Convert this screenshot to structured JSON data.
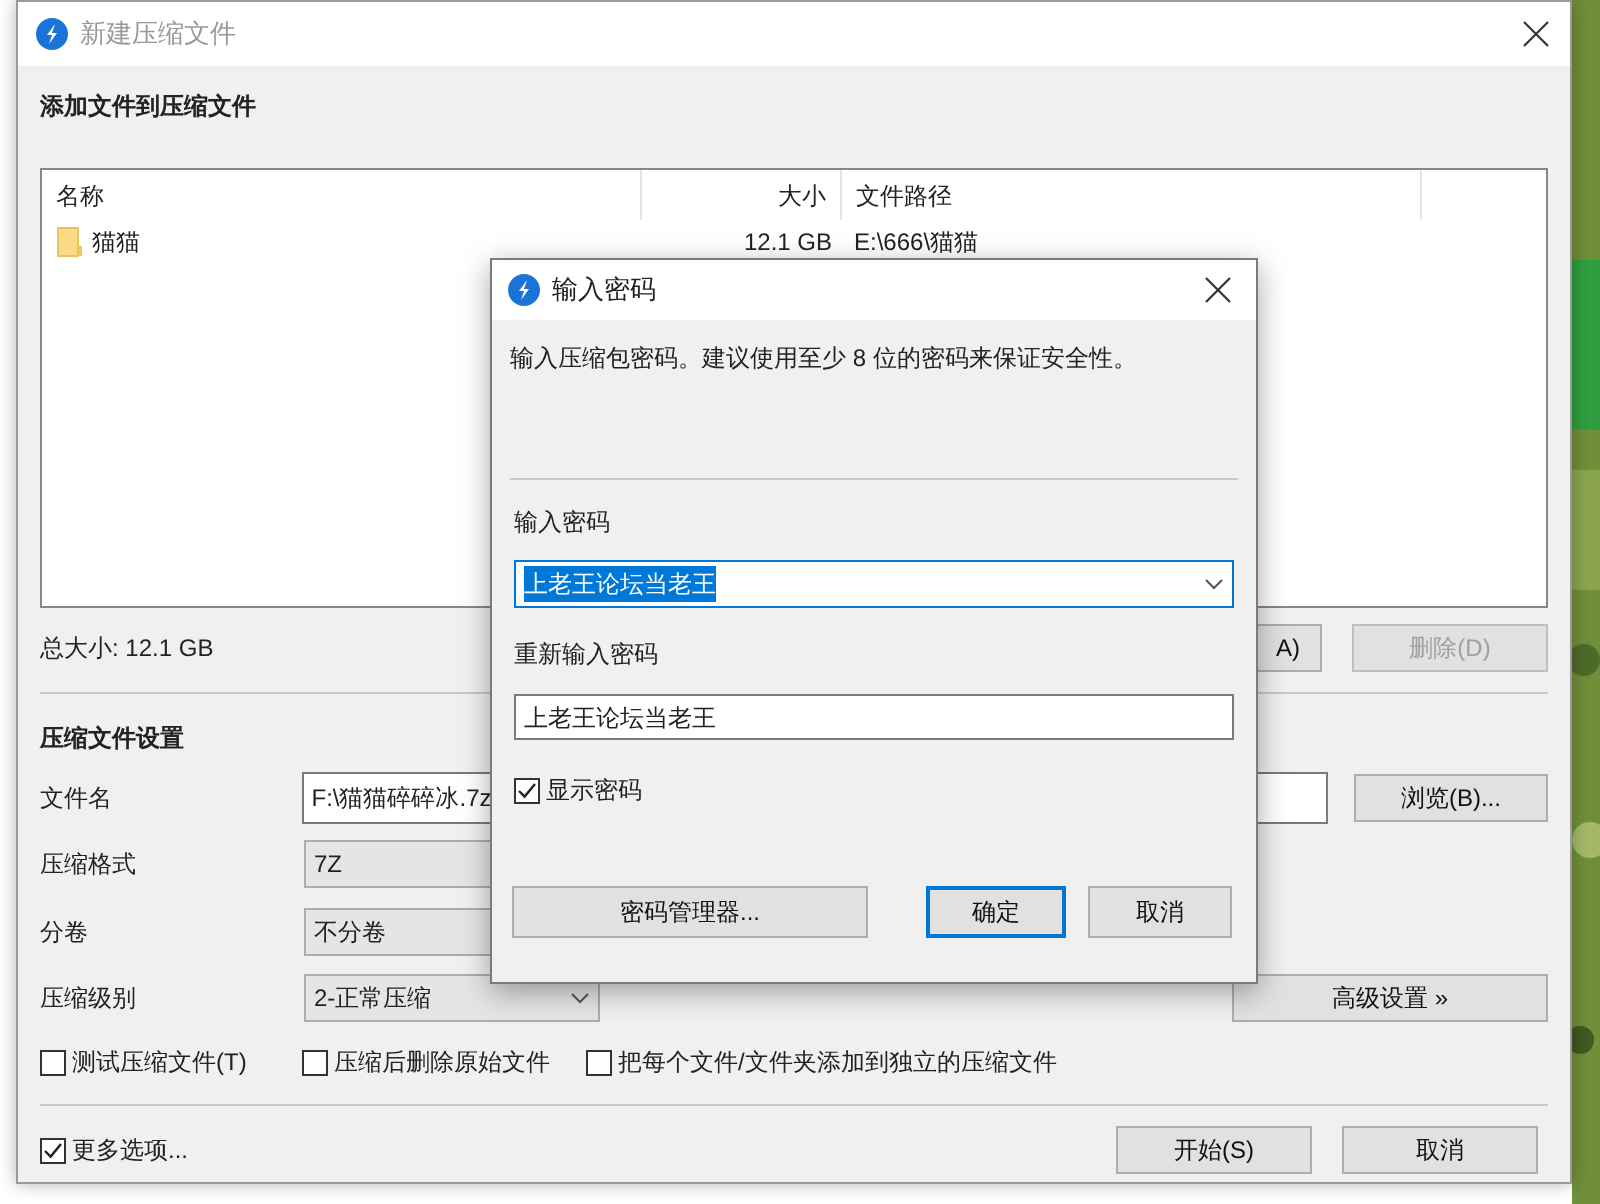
{
  "main_window": {
    "title": "新建压缩文件",
    "heading": "添加文件到压缩文件",
    "file_list": {
      "columns": [
        "名称",
        "大小",
        "文件路径"
      ],
      "rows": [
        {
          "name": "猫猫",
          "size": "12.1 GB",
          "path": "E:\\666\\猫猫"
        }
      ]
    },
    "total_size": "总大小: 12.1 GB",
    "list_buttons": [
      {
        "label": "A)",
        "disabled": false
      },
      {
        "label": "删除(D)",
        "disabled": true
      }
    ],
    "settings_heading": "压缩文件设置",
    "file_name": {
      "label": "文件名",
      "value": "F:\\猫猫碎碎冰.7z"
    },
    "browse_button": "浏览(B)...",
    "format": {
      "label": "压缩格式",
      "value": "7Z"
    },
    "split": {
      "label": "分卷",
      "value": "不分卷"
    },
    "level": {
      "label": "压缩级别",
      "value": "2-正常压缩"
    },
    "advanced_button": "高级设置 »",
    "options": [
      {
        "label": "测试压缩文件(T)",
        "checked": false
      },
      {
        "label": "压缩后删除原始文件",
        "checked": false
      },
      {
        "label": "把每个文件/文件夹添加到独立的压缩文件",
        "checked": false
      }
    ],
    "more_options": {
      "label": "更多选项...",
      "checked": true
    },
    "buttons": [
      "开始(S)",
      "取消"
    ]
  },
  "password_dialog": {
    "title": "输入密码",
    "message": "输入压缩包密码。建议使用至少 8 位的密码来保证安全性。",
    "password": {
      "label": "输入密码",
      "value": "上老王论坛当老王",
      "text_selected": true
    },
    "confirm": {
      "label": "重新输入密码",
      "value": "上老王论坛当老王"
    },
    "show_password": {
      "label": "显示密码",
      "checked": true
    },
    "buttons": [
      {
        "label": "密码管理器...",
        "default": false
      },
      {
        "label": "确定",
        "default": true
      },
      {
        "label": "取消",
        "default": false
      }
    ]
  }
}
